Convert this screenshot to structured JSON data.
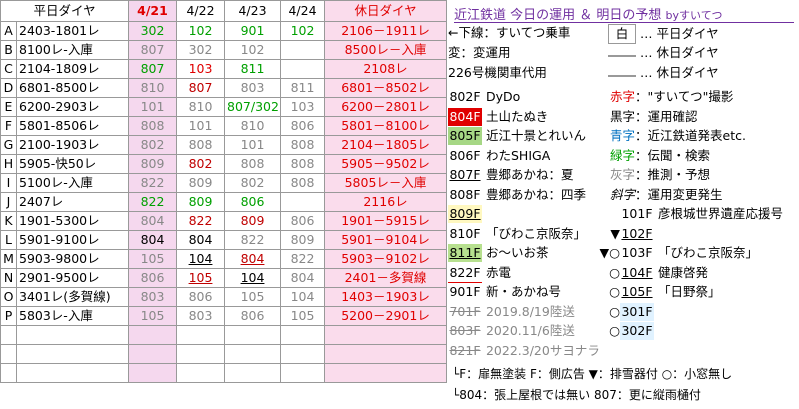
{
  "header": {
    "label": "平日ダイヤ",
    "dates": [
      "4/21",
      "4/22",
      "4/23",
      "4/24"
    ],
    "holiday": "休日ダイヤ"
  },
  "rows": [
    {
      "id": "A",
      "main": "2403-1801レ",
      "d": [
        "302",
        "102",
        "901",
        "102"
      ],
      "h": "2106－1911レ"
    },
    {
      "id": "B",
      "main": "8100レ-入庫",
      "d": [
        "807",
        "302",
        "102",
        ""
      ],
      "h": "8500レ－入庫"
    },
    {
      "id": "C",
      "main": "2104-1809レ",
      "d": [
        "807",
        "103",
        "811",
        ""
      ],
      "h": "2108レ"
    },
    {
      "id": "D",
      "main": "6801-8500レ",
      "d": [
        "810",
        "807",
        "803",
        "811"
      ],
      "h": "6801－8502レ"
    },
    {
      "id": "E",
      "main": "6200-2903レ",
      "d": [
        "101",
        "810",
        "807/302",
        "103"
      ],
      "h": "6200－2801レ"
    },
    {
      "id": "F",
      "main": "5801-8506レ",
      "d": [
        "808",
        "101",
        "810",
        "806"
      ],
      "h": "5801－8100レ"
    },
    {
      "id": "G",
      "main": "2100-1903レ",
      "d": [
        "802",
        "808",
        "101",
        "808"
      ],
      "h": "2104－1805レ"
    },
    {
      "id": "H",
      "main": "5905-快50レ",
      "d": [
        "809",
        "802",
        "808",
        "808"
      ],
      "h": "5905－9502レ"
    },
    {
      "id": "I",
      "main": "5100レ-入庫",
      "d": [
        "822",
        "809",
        "802",
        "808"
      ],
      "h": "5805レ－入庫"
    },
    {
      "id": "J",
      "main": "2407レ",
      "d": [
        "822",
        "809",
        "806",
        ""
      ],
      "h": "2116レ"
    },
    {
      "id": "K",
      "main": "1901-5300レ",
      "d": [
        "804",
        "822",
        "809",
        "806"
      ],
      "h": "1901－5915レ"
    },
    {
      "id": "L",
      "main": "5901-9100レ",
      "d": [
        "804",
        "804",
        "822",
        "809"
      ],
      "h": "5901－9104レ"
    },
    {
      "id": "M",
      "main": "5903-9800レ",
      "d": [
        "105",
        "104",
        "804",
        "822"
      ],
      "h": "5903－9102レ"
    },
    {
      "id": "N",
      "main": "2901-9500レ",
      "d": [
        "806",
        "105",
        "104",
        "804"
      ],
      "h": "2401－多賀線"
    },
    {
      "id": "O",
      "main": "3401レ(多賀線)",
      "d": [
        "803",
        "806",
        "105",
        "104"
      ],
      "h": "1403－1903レ"
    },
    {
      "id": "P",
      "main": "5803レ-入庫",
      "d": [
        "105",
        "803",
        "806",
        "105"
      ],
      "h": "5200－2901レ"
    }
  ],
  "legend": {
    "title": "近江鉄道 今日の運用 ＆ 明日の予想",
    "by": "byすいてつ",
    "marks": [
      {
        "k": "←下線",
        "v": "：すいてつ乗車"
      },
      {
        "k": "変",
        "v": "：変運用"
      },
      {
        "k": "226号",
        "v": "機関車代用"
      }
    ],
    "swatches": [
      {
        "k": "白",
        "v": "… 平日ダイヤ"
      },
      {
        "k": "",
        "v": "… 休日ダイヤ"
      },
      {
        "k": "",
        "v": "… 休日ダイヤ"
      }
    ],
    "cars": [
      {
        "no": "802F",
        "name": "DyDo",
        "color": "",
        "bg": "#ffffff"
      },
      {
        "no": "804F",
        "name": "土山たぬき",
        "color": "#fff",
        "bg": "#e00000"
      },
      {
        "no": "805F",
        "name": "近江十景とれいん",
        "color": "",
        "bg": "#a6d785"
      },
      {
        "no": "806F",
        "name": "わたSHIGA",
        "color": "",
        "bg": "#ffffff"
      },
      {
        "no": "807F",
        "name": "豊郷あかね：夏",
        "color": "",
        "bg": "#ffffff"
      },
      {
        "no": "808F",
        "name": "豊郷あかね：四季",
        "color": "",
        "bg": "#ffffff"
      },
      {
        "no": "809F",
        "name": "",
        "color": "",
        "bg": "#fff8c0"
      },
      {
        "no": "810F",
        "name": "「びわこ京阪奈」",
        "color": "",
        "bg": "#ffffff"
      },
      {
        "no": "811F",
        "name": "お～いお茶",
        "color": "",
        "bg": "#b7e08f"
      },
      {
        "no": "822F",
        "name": "赤電",
        "color": "",
        "bg": "#ffffff"
      },
      {
        "no": "901F",
        "name": "新・あかね号",
        "color": "",
        "bg": "#ffffff"
      },
      {
        "no": "701F",
        "name": "2019.8/19陸送",
        "color": "#888",
        "bg": "#ffffff"
      },
      {
        "no": "803F",
        "name": "2020.11/6陸送",
        "color": "#888",
        "bg": "#ffffff"
      },
      {
        "no": "821F",
        "name": "2022.3/20サヨナラ",
        "color": "#888",
        "bg": "#ffffff"
      }
    ],
    "colorKey": [
      {
        "k": "赤字",
        "v": "：\"すいてつ\"撮影",
        "c": "#e00000"
      },
      {
        "k": "黒字",
        "v": "：運用確認",
        "c": "#000"
      },
      {
        "k": "青字",
        "v": "：近江鉄道発表etc.",
        "c": "#0070c0"
      },
      {
        "k": "緑字",
        "v": "：伝聞・検索",
        "c": "#00a000"
      },
      {
        "k": "灰字",
        "v": "：推測・予想",
        "c": "#888"
      },
      {
        "k": "斜字",
        "v": "：運用変更発生",
        "c": "#000"
      }
    ],
    "cars2": [
      {
        "no": "101F",
        "name": "彦根城世界遺産応援号",
        "pre": ""
      },
      {
        "no": "102F",
        "name": "",
        "pre": "▼"
      },
      {
        "no": "103F",
        "name": "「びわこ京阪奈」",
        "pre": "▼○"
      },
      {
        "no": "104F",
        "name": "健康啓発",
        "pre": "○"
      },
      {
        "no": "105F",
        "name": "「日野祭」",
        "pre": "○"
      },
      {
        "no": "301F",
        "name": "",
        "pre": "○"
      },
      {
        "no": "302F",
        "name": "",
        "pre": "○"
      }
    ],
    "note1": "└F：扉無塗装 F：側広告 ▼：排雪器付 ○：小窓無し",
    "note2": "└804：張上屋根では無い  807：更に縦雨樋付"
  }
}
